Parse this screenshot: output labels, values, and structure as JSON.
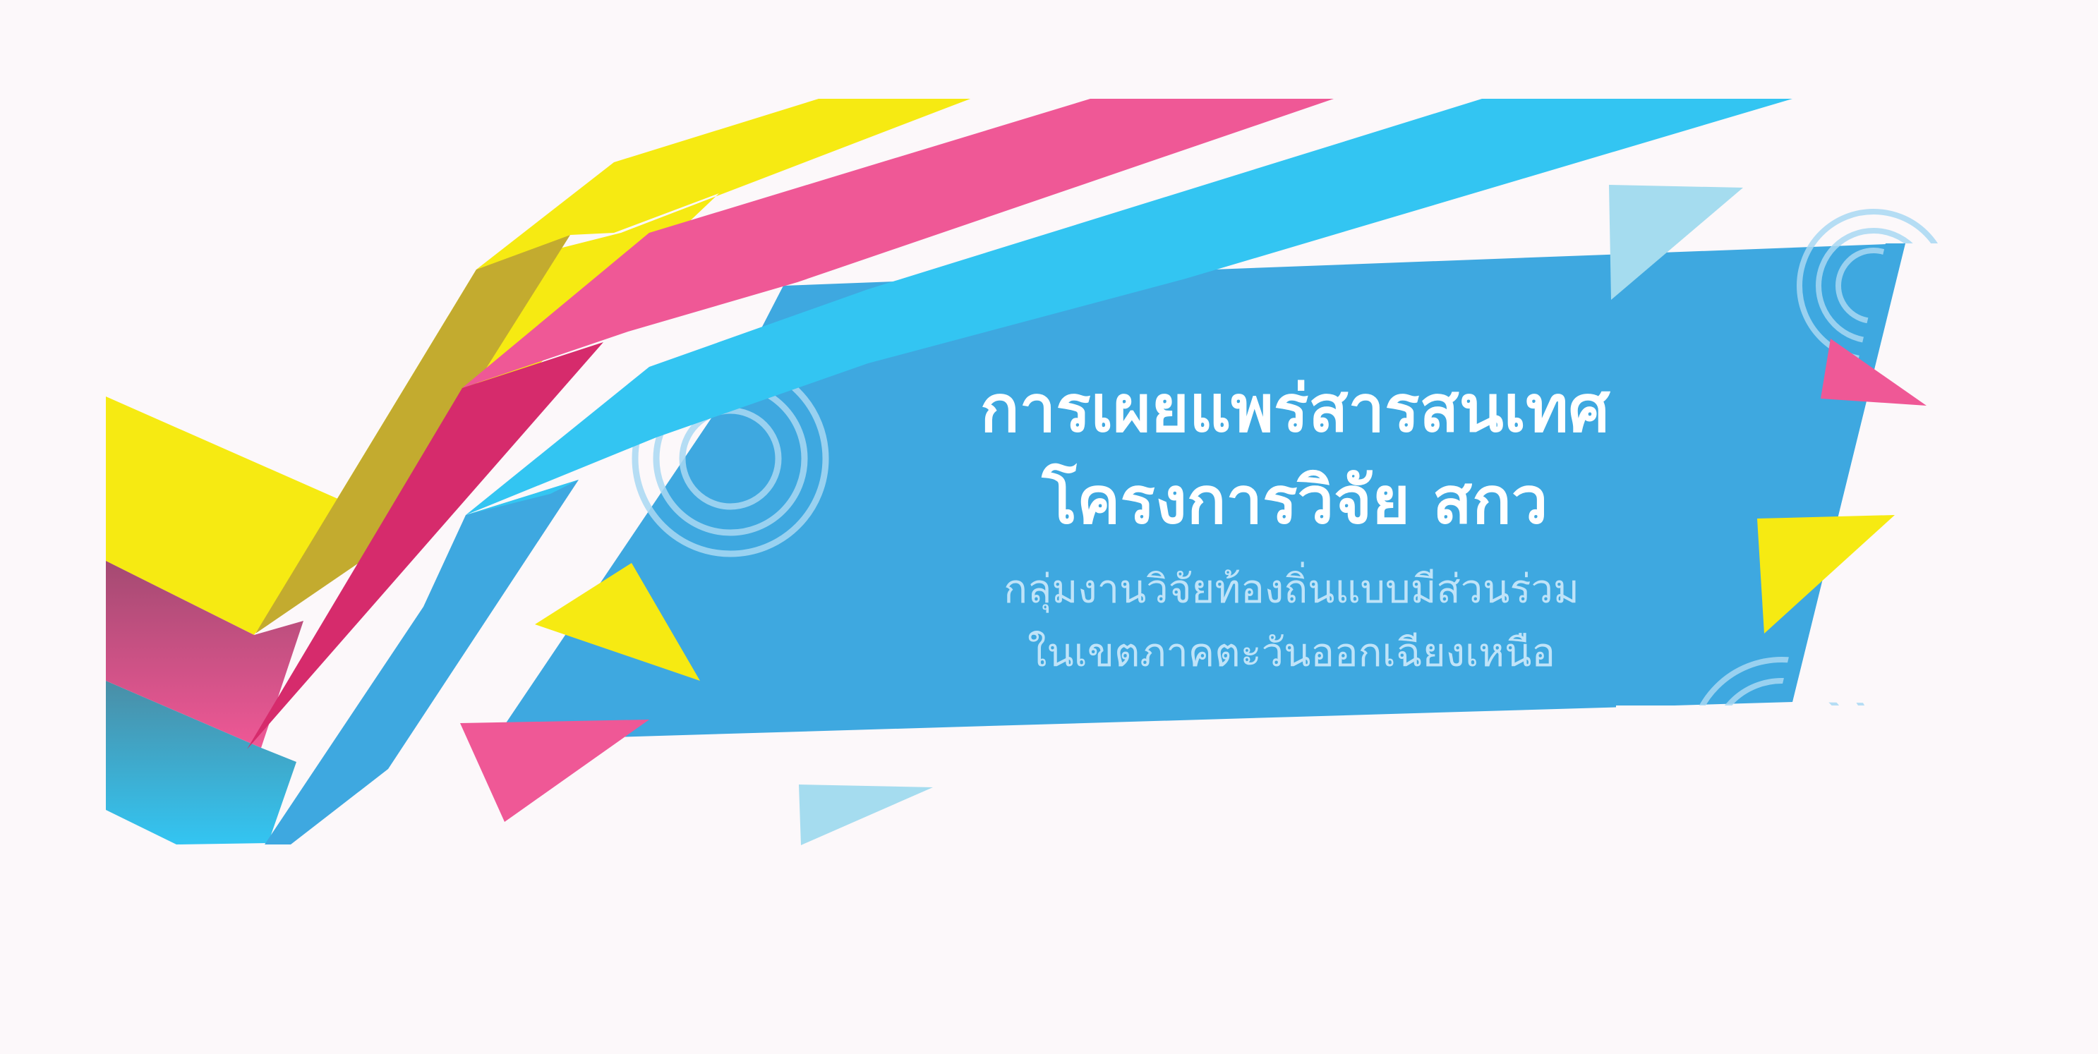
{
  "banner": {
    "title_line1": "การเผยแพร่สารสนเทศ",
    "title_line2": "โครงการวิจัย สกว",
    "subtitle_line1": "กลุ่มงานวิจัยท้องถิ่นแบบมีส่วนร่วม",
    "subtitle_line2": "ในเขตภาคตะวันออกเฉียงเหนือ"
  },
  "colors": {
    "background": "#fcf8fa",
    "panel_blue": "#3ea8e0",
    "ribbon_cyan": "#33c5f2",
    "ribbon_pink": "#ef5896",
    "ribbon_yellow": "#f6ea12",
    "light_blue": "#a5dcef",
    "title_text": "#ffffff",
    "subtitle_text": "#bfe3f8"
  }
}
